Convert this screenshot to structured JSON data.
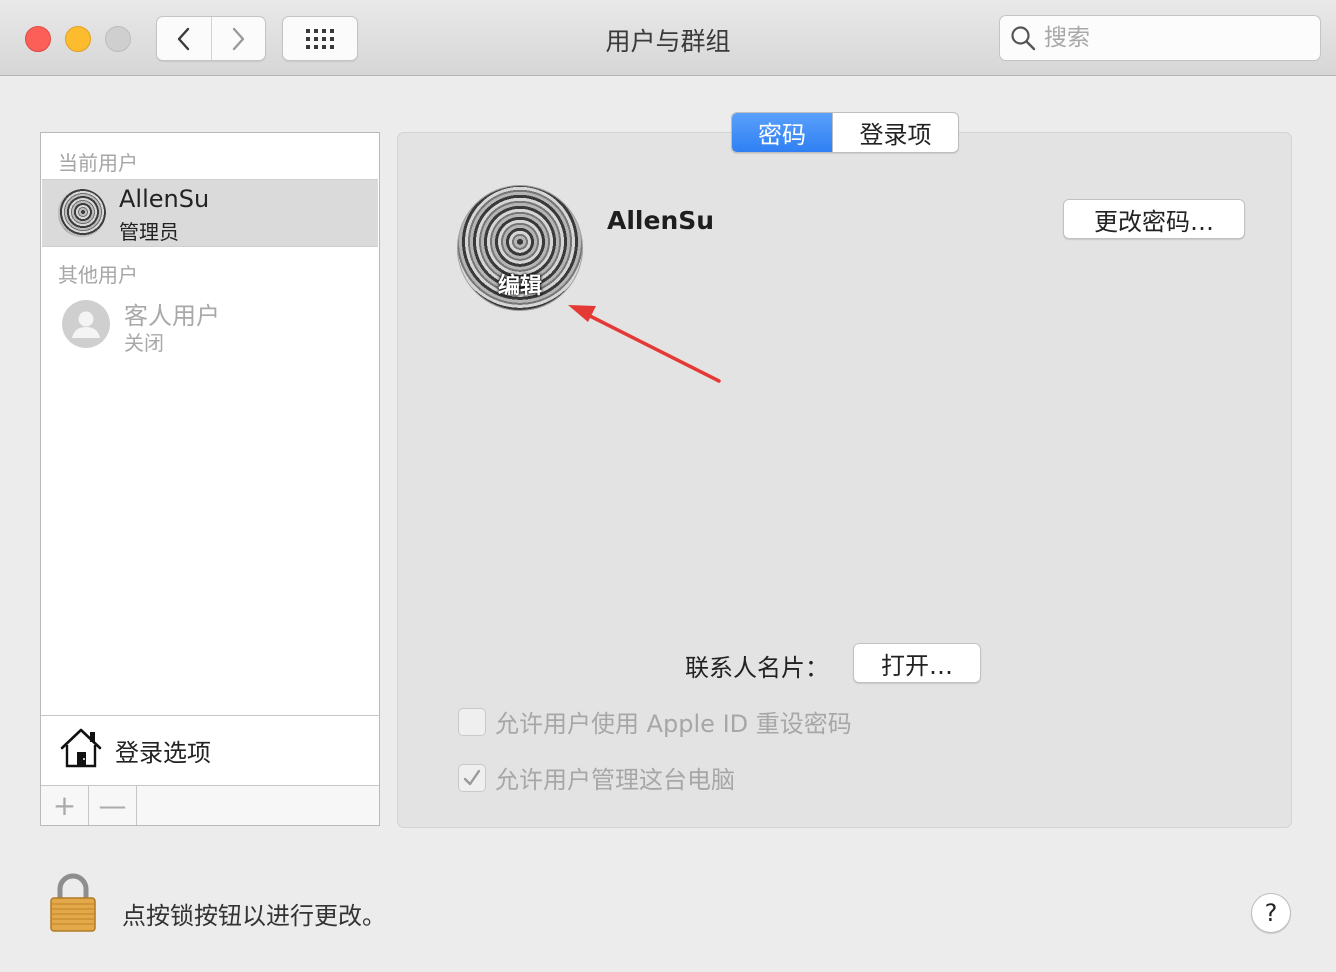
{
  "window": {
    "title": "用户与群组",
    "search_placeholder": "搜索"
  },
  "sidebar": {
    "current_users_header": "当前用户",
    "current_user": {
      "name": "AllenSu",
      "role": "管理员"
    },
    "other_users_header": "其他用户",
    "guest_user": {
      "name": "客人用户",
      "status": "关闭"
    },
    "login_options_label": "登录选项",
    "add_symbol": "+",
    "remove_symbol": "—"
  },
  "tabs": [
    {
      "label": "密码",
      "active": true
    },
    {
      "label": "登录项",
      "active": false
    }
  ],
  "profile": {
    "name": "AllenSu",
    "edit_label": "编辑",
    "change_password_label": "更改密码…",
    "contact_card_label": "联系人名片：",
    "open_label": "打开…",
    "allow_apple_id_reset": {
      "label": "允许用户使用 Apple ID 重设密码",
      "checked": false
    },
    "allow_admin": {
      "label": "允许用户管理这台电脑",
      "checked": true
    }
  },
  "footer": {
    "lock_text": "点按锁按钮以进行更改。",
    "help_symbol": "?"
  },
  "colors": {
    "accent": "#2f80f4",
    "annotation_arrow": "#e53935"
  }
}
